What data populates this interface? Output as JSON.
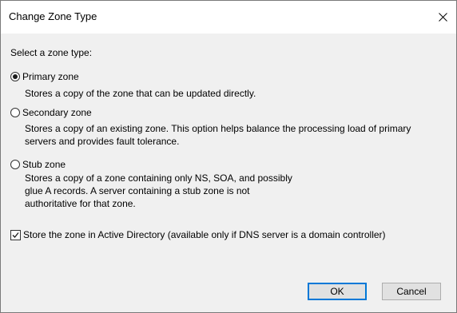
{
  "dialog": {
    "title": "Change Zone Type",
    "close_glyph": "close-icon"
  },
  "prompt": "Select a zone type:",
  "options": [
    {
      "label": "Primary zone",
      "selected": true,
      "description": "Stores a copy of the zone that can be updated directly."
    },
    {
      "label": "Secondary zone",
      "selected": false,
      "description": "Stores a copy of an existing zone. This option helps balance the processing load of primary servers and provides fault tolerance."
    },
    {
      "label": "Stub zone",
      "selected": false,
      "description_lines": [
        "Stores a copy of a zone containing only NS, SOA, and possibly",
        "glue A records. A server containing a stub zone is not",
        "authoritative for that zone."
      ]
    }
  ],
  "ad_checkbox": {
    "label": "Store the zone in Active Directory (available only if DNS server is a domain controller)",
    "checked": true
  },
  "buttons": {
    "ok": "OK",
    "cancel": "Cancel"
  }
}
